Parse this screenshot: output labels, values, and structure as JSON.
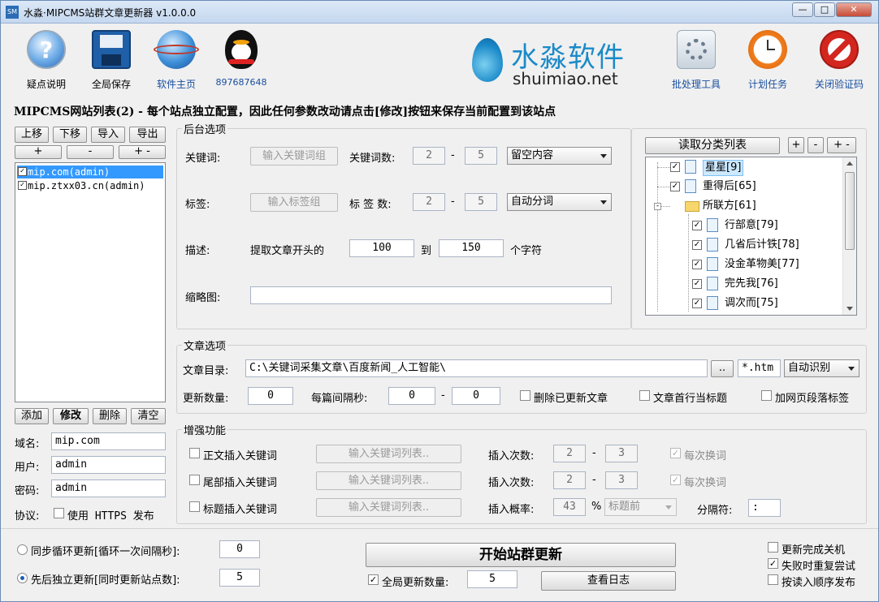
{
  "window": {
    "title": "水淼·MIPCMS站群文章更新器 v1.0.0.0",
    "icon_text": "SM"
  },
  "toolbar": {
    "items": [
      {
        "label": "疑点说明",
        "icon": "help-icon"
      },
      {
        "label": "全局保存",
        "icon": "floppy-disk-icon"
      },
      {
        "label": "软件主页",
        "icon": "globe-icon"
      },
      {
        "label": "897687648",
        "icon": "qq-penguin-icon"
      },
      {
        "label": "批处理工具",
        "icon": "gear-icon"
      },
      {
        "label": "计划任务",
        "icon": "clock-icon"
      },
      {
        "label": "关闭验证码",
        "icon": "prohibited-icon"
      }
    ],
    "logo": {
      "cn": "水淼软件",
      "en": "shuimiao.net"
    }
  },
  "heading": "MIPCMS网站列表(2) - 每个站点独立配置，因此任何参数改动请点击[修改]按钮来保存当前配置到该站点",
  "site_panel": {
    "buttons_row1": [
      "上移",
      "下移",
      "导入",
      "导出"
    ],
    "buttons_row2": [
      "+",
      "-",
      "+ -"
    ],
    "sites": [
      {
        "name": "mip.com(admin)",
        "checked": true,
        "selected": true
      },
      {
        "name": "mip.ztxx03.cn(admin)",
        "checked": true,
        "selected": false
      }
    ],
    "actions": [
      "添加",
      "修改",
      "删除",
      "清空"
    ],
    "domain_label": "域名:",
    "domain_value": "mip.com",
    "user_label": "用户:",
    "user_value": "admin",
    "password_label": "密码:",
    "password_value": "admin",
    "protocol_label": "协议:",
    "https_label": "使用 HTTPS 发布",
    "https_checked": false
  },
  "backend": {
    "title": "后台选项",
    "keyword_label": "关键词:",
    "keyword_button": "输入关键词组",
    "keyword_count_label": "关键词数:",
    "keyword_min": "2",
    "keyword_max": "5",
    "keyword_mode": "留空内容",
    "tag_label": "标签:",
    "tag_button": "输入标签组",
    "tag_count_label": "标 签 数:",
    "tag_min": "2",
    "tag_max": "5",
    "tag_mode": "自动分词",
    "desc_label": "描述:",
    "desc_prefix": "提取文章开头的",
    "desc_from": "100",
    "desc_to_label": "到",
    "desc_to": "150",
    "desc_suffix": "个字符",
    "thumb_label": "缩略图:",
    "thumb_value": "",
    "dash": "-"
  },
  "category": {
    "read_button": "读取分类列表",
    "small_buttons": [
      "+",
      "-",
      "+",
      "-"
    ],
    "tree": [
      {
        "label": "星星[9]",
        "level": 0,
        "type": "doc",
        "checked": true,
        "selected": true
      },
      {
        "label": "重得后[65]",
        "level": 0,
        "type": "doc",
        "checked": true,
        "selected": false
      },
      {
        "label": "所联方[61]",
        "level": 0,
        "type": "folder",
        "checked": false,
        "selected": false
      },
      {
        "label": "行部意[79]",
        "level": 1,
        "type": "doc",
        "checked": true,
        "selected": false
      },
      {
        "label": "几省后计铁[78]",
        "level": 1,
        "type": "doc",
        "checked": true,
        "selected": false
      },
      {
        "label": "没金革物美[77]",
        "level": 1,
        "type": "doc",
        "checked": true,
        "selected": false
      },
      {
        "label": "完先我[76]",
        "level": 1,
        "type": "doc",
        "checked": true,
        "selected": false
      },
      {
        "label": "调次而[75]",
        "level": 1,
        "type": "doc",
        "checked": true,
        "selected": false
      }
    ]
  },
  "article": {
    "title": "文章选项",
    "dir_label": "文章目录:",
    "dir_value": "C:\\关键词采集文章\\百度新闻_人工智能\\",
    "browse_button": "..",
    "ext_value": "*.htm",
    "encoding": "自动识别",
    "count_label": "更新数量:",
    "count_value": "0",
    "interval_label": "每篇间隔秒:",
    "interval_min": "0",
    "interval_max": "0",
    "delete_label": "删除已更新文章",
    "firstline_label": "文章首行当标题",
    "paragraph_label": "加网页段落标签"
  },
  "enhance": {
    "title": "增强功能",
    "rows": [
      {
        "label": "正文插入关键词",
        "button": "输入关键词列表..",
        "count_label": "插入次数:",
        "min": "2",
        "max": "3",
        "each_label": "每次换词",
        "each_checked": true
      },
      {
        "label": "尾部插入关键词",
        "button": "输入关键词列表..",
        "count_label": "插入次数:",
        "min": "2",
        "max": "3",
        "each_label": "每次换词",
        "each_checked": true
      }
    ],
    "title_row": {
      "label": "标题插入关键词",
      "button": "输入关键词列表..",
      "prob_label": "插入概率:",
      "prob_value": "43",
      "percent": "%",
      "position": "标题前",
      "sep_label": "分隔符:",
      "sep_value": ":"
    }
  },
  "bottom": {
    "sync_label": "同步循环更新[循环一次间隔秒]:",
    "sync_value": "0",
    "seq_label": "先后独立更新[同时更新站点数]:",
    "seq_value": "5",
    "start_button": "开始站群更新",
    "global_count_label": "全局更新数量:",
    "global_count_value": "5",
    "global_count_checked": true,
    "log_button": "查看日志",
    "shutdown_label": "更新完成关机",
    "retry_label": "失败时重复尝试",
    "order_label": "按读入顺序发布"
  }
}
